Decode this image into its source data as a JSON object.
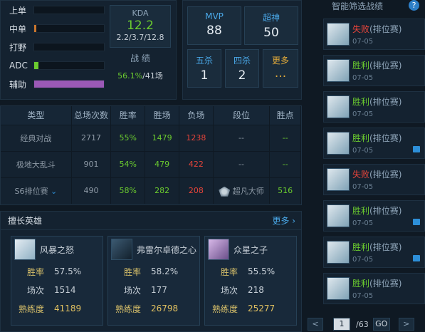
{
  "lanes": [
    {
      "name": "上单",
      "fill": 0,
      "color": "#c9762e"
    },
    {
      "name": "中单",
      "fill": 0.03,
      "color": "#c9762e"
    },
    {
      "name": "打野",
      "fill": 0,
      "color": "#c9762e"
    },
    {
      "name": "ADC",
      "fill": 0.06,
      "color": "#6bcb2f"
    },
    {
      "name": "辅助",
      "fill": 1.0,
      "color": "#9b59b6"
    }
  ],
  "kda": {
    "label": "KDA",
    "value": "12.2",
    "k": "2.2",
    "d": "3.7",
    "a": "12.8",
    "sep": "/"
  },
  "record": {
    "label": "战 绩",
    "rate": "56.1%",
    "games": "41场",
    "sep": "/"
  },
  "honors": {
    "mvp_label": "MVP",
    "mvp": "88",
    "god_label": "超神",
    "god": "50",
    "penta_label": "五杀",
    "penta": "1",
    "quadra_label": "四杀",
    "quadra": "2",
    "more_label": "更多",
    "more": "..."
  },
  "table": {
    "headers": [
      "类型",
      "总场次数",
      "胜率",
      "胜场",
      "负场",
      "段位",
      "胜点"
    ],
    "rows": [
      {
        "type": "经典对战",
        "total": "2717",
        "rate": "55%",
        "wins": "1479",
        "losses": "1238",
        "rank": "--",
        "points": "--"
      },
      {
        "type": "极地大乱斗",
        "total": "901",
        "rate": "54%",
        "wins": "479",
        "losses": "422",
        "rank": "--",
        "points": "--"
      },
      {
        "type": "S6排位赛",
        "total": "490",
        "rate": "58%",
        "wins": "282",
        "losses": "208",
        "rank": "超凡大师",
        "points": "516"
      }
    ]
  },
  "heroes": {
    "title": "擅长英雄",
    "more": "更多",
    "labels": {
      "rate": "胜率",
      "games": "场次",
      "mastery": "熟练度"
    },
    "cards": [
      {
        "name": "风暴之怒",
        "rate": "57.5%",
        "games": "1514",
        "mastery": "41189"
      },
      {
        "name": "弗雷尔卓德之心",
        "rate": "58.2%",
        "games": "177",
        "mastery": "26798"
      },
      {
        "name": "众星之子",
        "rate": "55.5%",
        "games": "218",
        "mastery": "25277"
      }
    ]
  },
  "matches": {
    "title": "智能筛选战绩",
    "help": "?",
    "mode": "(排位赛)",
    "items": [
      {
        "result": "失败",
        "date": "07-05",
        "win": false,
        "icon": false
      },
      {
        "result": "胜利",
        "date": "07-05",
        "win": true,
        "icon": false
      },
      {
        "result": "胜利",
        "date": "07-05",
        "win": true,
        "icon": false
      },
      {
        "result": "胜利",
        "date": "07-05",
        "win": true,
        "icon": true
      },
      {
        "result": "失败",
        "date": "07-05",
        "win": false,
        "icon": false
      },
      {
        "result": "胜利",
        "date": "07-05",
        "win": true,
        "icon": true
      },
      {
        "result": "胜利",
        "date": "07-05",
        "win": true,
        "icon": true
      },
      {
        "result": "胜利",
        "date": "07-05",
        "win": true,
        "icon": false
      }
    ],
    "pager": {
      "prev": "<",
      "page": "1",
      "total": "/63",
      "go": "GO",
      "next": ">"
    }
  },
  "colors": {
    "win": "#6bcb2f",
    "loss": "#e6443a",
    "accent": "#2d8fd8"
  }
}
